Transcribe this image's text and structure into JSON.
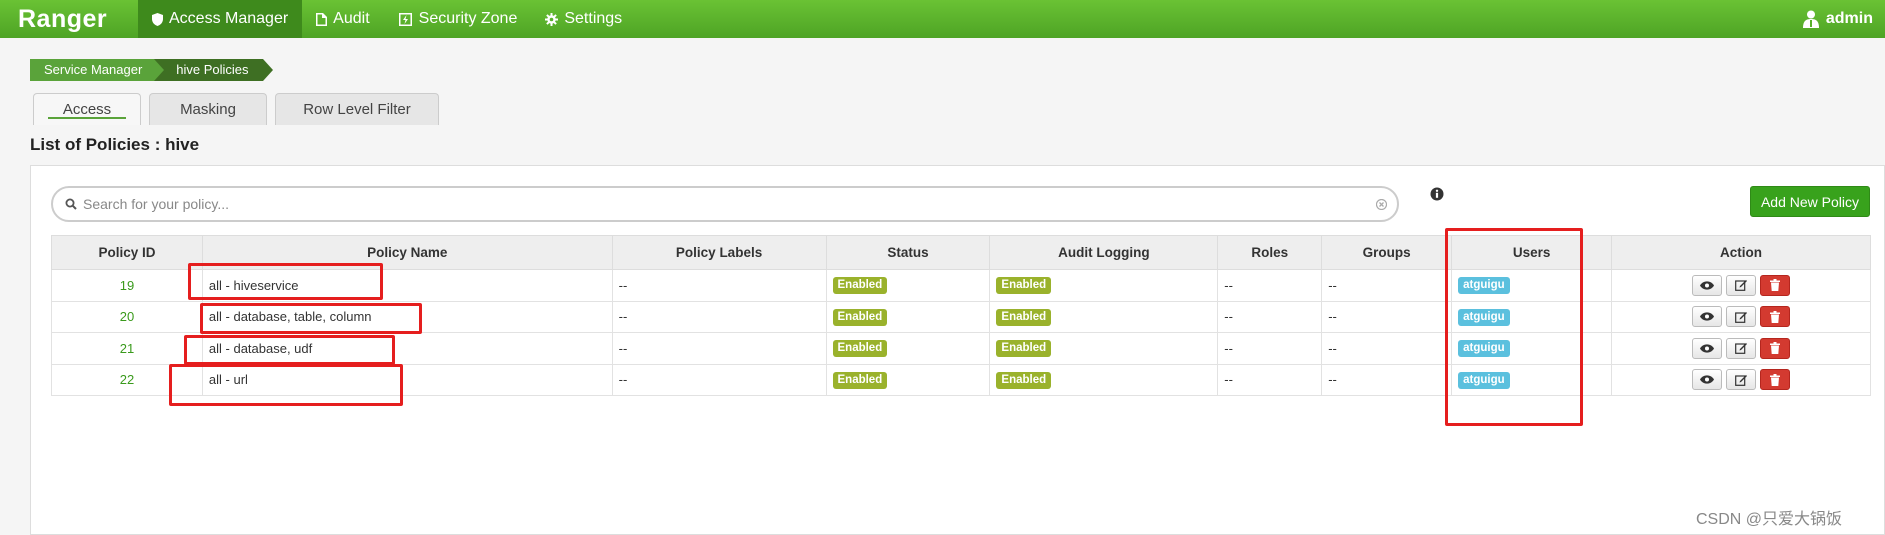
{
  "app": {
    "brand": "Ranger",
    "user": "admin"
  },
  "nav": [
    {
      "label": "Access Manager",
      "icon": "shield-icon",
      "active": true
    },
    {
      "label": "Audit",
      "icon": "file-icon"
    },
    {
      "label": "Security Zone",
      "icon": "bolt-icon"
    },
    {
      "label": "Settings",
      "icon": "gear-icon"
    }
  ],
  "breadcrumb": [
    "Service Manager",
    "hive Policies"
  ],
  "tabs": [
    {
      "label": "Access",
      "active": true
    },
    {
      "label": "Masking"
    },
    {
      "label": "Row Level Filter"
    }
  ],
  "page": {
    "title": "List of Policies : hive"
  },
  "search": {
    "placeholder": "Search for your policy..."
  },
  "toolbar": {
    "add_label": "Add New Policy"
  },
  "table": {
    "columns": [
      "Policy ID",
      "Policy Name",
      "Policy Labels",
      "Status",
      "Audit Logging",
      "Roles",
      "Groups",
      "Users",
      "Action"
    ],
    "rows": [
      {
        "id": "19",
        "name": "all - hiveservice",
        "labels": "--",
        "status": "Enabled",
        "audit": "Enabled",
        "roles": "--",
        "groups": "--",
        "users": "atguigu"
      },
      {
        "id": "20",
        "name": "all - database, table, column",
        "labels": "--",
        "status": "Enabled",
        "audit": "Enabled",
        "roles": "--",
        "groups": "--",
        "users": "atguigu"
      },
      {
        "id": "21",
        "name": "all - database, udf",
        "labels": "--",
        "status": "Enabled",
        "audit": "Enabled",
        "roles": "--",
        "groups": "--",
        "users": "atguigu"
      },
      {
        "id": "22",
        "name": "all - url",
        "labels": "--",
        "status": "Enabled",
        "audit": "Enabled",
        "roles": "--",
        "groups": "--",
        "users": "atguigu"
      }
    ]
  },
  "watermark": "CSDN @只爱大锅饭",
  "colors": {
    "header": "#58b22b",
    "accent": "#38a21c",
    "status_label": "#9ab22c",
    "user_label": "#5bc0de",
    "delete": "#d33a30",
    "highlight": "#e51e1e"
  }
}
